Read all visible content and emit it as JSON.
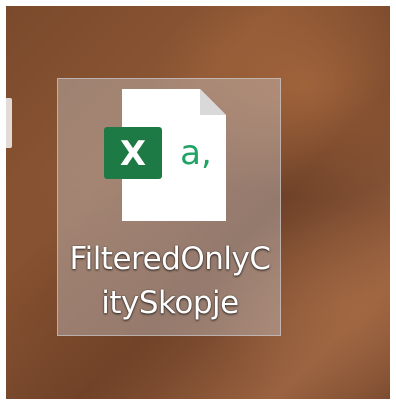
{
  "desktop": {
    "file": {
      "name_line1": "FilteredOnlyC",
      "name_line2": "itySkopje",
      "icon": "excel-csv-file-icon",
      "badge_letter": "X",
      "page_glyph": "a,",
      "selected": true
    }
  },
  "colors": {
    "excel_green": "#1d7a45",
    "page_text_green": "#21a366"
  }
}
